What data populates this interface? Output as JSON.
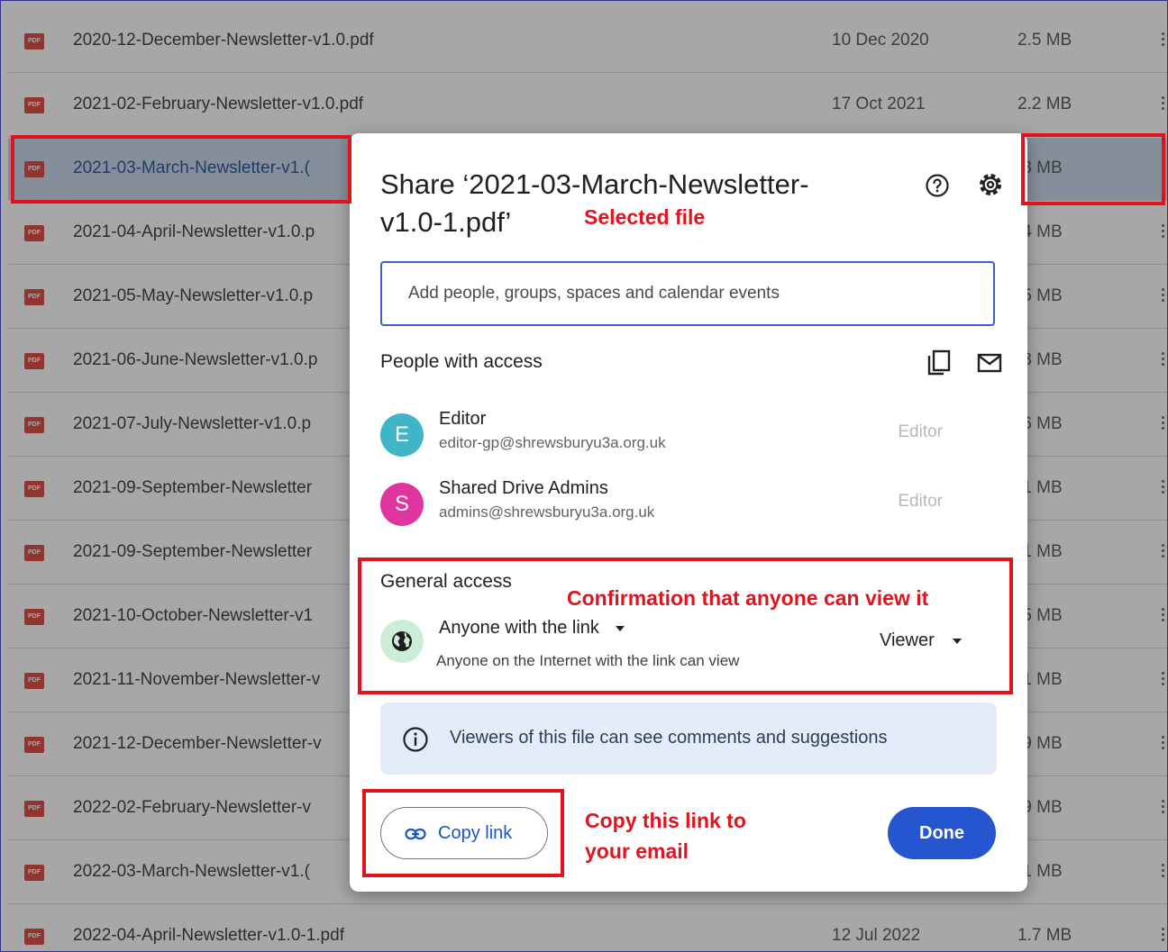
{
  "files": [
    {
      "name": "2020-12-December-Newsletter-v1.0.pdf",
      "date": "10 Dec 2020",
      "size": "2.5 MB"
    },
    {
      "name": "2021-02-February-Newsletter-v1.0.pdf",
      "date": "17 Oct 2021",
      "size": "2.2 MB"
    },
    {
      "name": "2021-03-March-Newsletter-v1.(",
      "date": "",
      "size": ".8 MB",
      "selected": true
    },
    {
      "name": "2021-04-April-Newsletter-v1.0.p",
      "date": "",
      "size": ".4 MB"
    },
    {
      "name": "2021-05-May-Newsletter-v1.0.p",
      "date": "",
      "size": ".5 MB"
    },
    {
      "name": "2021-06-June-Newsletter-v1.0.p",
      "date": "",
      "size": ".3 MB"
    },
    {
      "name": "2021-07-July-Newsletter-v1.0.p",
      "date": "",
      "size": ".6 MB"
    },
    {
      "name": "2021-09-September-Newsletter",
      "date": "",
      "size": ".1 MB"
    },
    {
      "name": "2021-09-September-Newsletter",
      "date": "",
      "size": ".1 MB"
    },
    {
      "name": "2021-10-October-Newsletter-v1",
      "date": "",
      "size": ".5 MB"
    },
    {
      "name": "2021-11-November-Newsletter-v",
      "date": "",
      "size": ".1 MB"
    },
    {
      "name": "2021-12-December-Newsletter-v",
      "date": "",
      "size": ".9 MB"
    },
    {
      "name": "2022-02-February-Newsletter-v",
      "date": "",
      "size": ".9 MB"
    },
    {
      "name": "2022-03-March-Newsletter-v1.(",
      "date": "",
      "size": ".1 MB"
    },
    {
      "name": "2022-04-April-Newsletter-v1.0-1.pdf",
      "date": "12 Jul 2022",
      "size": "1.7 MB"
    }
  ],
  "pdf_icon_label": "PDF",
  "dialog": {
    "title": "Share ‘2021-03-March-Newsletter-v1.0-1.pdf’",
    "help_icon": "help-circle-icon",
    "settings_icon": "gear-icon",
    "add_people_placeholder": "Add people, groups, spaces and calendar events",
    "people_section_label": "People with access",
    "people": [
      {
        "initial": "E",
        "name": "Editor",
        "email": "editor-gp@shrewsburyu3a.org.uk",
        "role": "Editor",
        "avatar_color": "#3fb5c7"
      },
      {
        "initial": "S",
        "name": "Shared Drive Admins",
        "email": "admins@shrewsburyu3a.org.uk",
        "role": "Editor",
        "avatar_color": "#e0359e"
      }
    ],
    "general_access_label": "General access",
    "link_access": "Anyone with the link",
    "link_access_desc": "Anyone on the Internet with the link can view",
    "link_role": "Viewer",
    "info_text": "Viewers of this file can see comments and suggestions",
    "copy_link_label": "Copy link",
    "done_label": "Done"
  },
  "annotations": {
    "selected_file": "Selected file",
    "confirmation": "Confirmation that anyone can view it",
    "copy_link_line1": "Copy this link to",
    "copy_link_line2": "your email"
  },
  "colors": {
    "primary_blue": "#2556d0",
    "annotation_red": "#e0141e",
    "selected_row": "#c2d4ea",
    "pdf_red": "#d93025"
  }
}
